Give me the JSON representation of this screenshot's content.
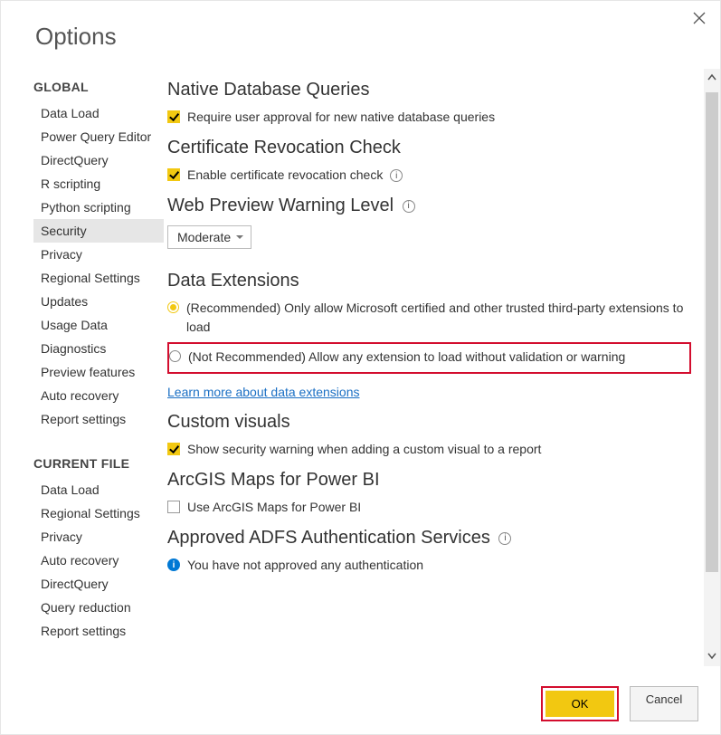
{
  "title": "Options",
  "sidebar": {
    "sections": [
      {
        "header": "GLOBAL",
        "items": [
          {
            "label": "Data Load",
            "sel": false
          },
          {
            "label": "Power Query Editor",
            "sel": false
          },
          {
            "label": "DirectQuery",
            "sel": false
          },
          {
            "label": "R scripting",
            "sel": false
          },
          {
            "label": "Python scripting",
            "sel": false
          },
          {
            "label": "Security",
            "sel": true
          },
          {
            "label": "Privacy",
            "sel": false
          },
          {
            "label": "Regional Settings",
            "sel": false
          },
          {
            "label": "Updates",
            "sel": false
          },
          {
            "label": "Usage Data",
            "sel": false
          },
          {
            "label": "Diagnostics",
            "sel": false
          },
          {
            "label": "Preview features",
            "sel": false
          },
          {
            "label": "Auto recovery",
            "sel": false
          },
          {
            "label": "Report settings",
            "sel": false
          }
        ]
      },
      {
        "header": "CURRENT FILE",
        "items": [
          {
            "label": "Data Load",
            "sel": false
          },
          {
            "label": "Regional Settings",
            "sel": false
          },
          {
            "label": "Privacy",
            "sel": false
          },
          {
            "label": "Auto recovery",
            "sel": false
          },
          {
            "label": "DirectQuery",
            "sel": false
          },
          {
            "label": "Query reduction",
            "sel": false
          },
          {
            "label": "Report settings",
            "sel": false
          }
        ]
      }
    ]
  },
  "main": {
    "native_db": {
      "header": "Native Database Queries",
      "require": "Require user approval for new native database queries"
    },
    "cert": {
      "header": "Certificate Revocation Check",
      "enable": "Enable certificate revocation check"
    },
    "web_preview": {
      "header": "Web Preview Warning Level",
      "value": "Moderate"
    },
    "data_ext": {
      "header": "Data Extensions",
      "opt1": "(Recommended) Only allow Microsoft certified and other trusted third-party extensions to load",
      "opt2": "(Not Recommended) Allow any extension to load without validation or warning",
      "link": "Learn more about data extensions"
    },
    "custom_visuals": {
      "header": "Custom visuals",
      "chk": "Show security warning when adding a custom visual to a report"
    },
    "arcgis": {
      "header": "ArcGIS Maps for Power BI",
      "chk": "Use ArcGIS Maps for Power BI"
    },
    "adfs": {
      "header": "Approved ADFS Authentication Services",
      "msg": "You have not approved any authentication"
    }
  },
  "footer": {
    "ok": "OK",
    "cancel": "Cancel"
  }
}
